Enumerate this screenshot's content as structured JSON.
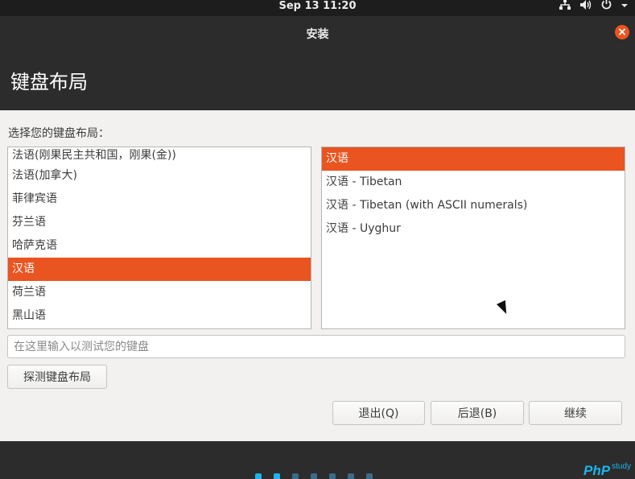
{
  "topbar": {
    "clock": "Sep 13  11:20",
    "icons": [
      "network-icon",
      "volume-icon",
      "power-icon",
      "chevron-down-icon"
    ]
  },
  "window": {
    "title": "安装",
    "close_icon": "close-icon"
  },
  "header": {
    "title": "键盘布局"
  },
  "content": {
    "prompt": "选择您的键盘布局：",
    "layouts": [
      "法语(刚果民主共和国，刚果(金))",
      "法语(加拿大)",
      "菲律宾语",
      "芬兰语",
      "哈萨克语",
      "汉语",
      "荷兰语",
      "黑山语"
    ],
    "selected_layout_index": 5,
    "variants": [
      "汉语",
      "汉语 - Tibetan",
      "汉语 - Tibetan (with ASCII numerals)",
      "汉语 - Uyghur"
    ],
    "selected_variant_index": 0,
    "test_placeholder": "在这里输入以测试您的键盘",
    "detect_label": "探测键盘布局"
  },
  "buttons": {
    "quit": "退出(Q)",
    "back": "后退(B)",
    "next": "继续"
  },
  "footer": {
    "progress_done": 2,
    "progress_total": 7,
    "brand_main": "PhP",
    "brand_sub": "study"
  },
  "colors": {
    "accent": "#e95420",
    "dark": "#2c2c2c",
    "progress": "#19b6ee"
  }
}
